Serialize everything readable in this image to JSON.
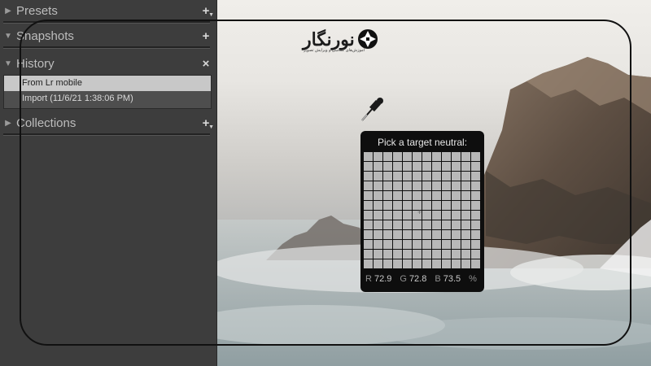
{
  "left_panel": {
    "sections": {
      "presets": {
        "title": "Presets",
        "action": "+"
      },
      "snapshots": {
        "title": "Snapshots",
        "action": "+"
      },
      "history": {
        "title": "History",
        "action": "×"
      },
      "collections": {
        "title": "Collections",
        "action": "+"
      }
    },
    "history_items": [
      "From Lr mobile",
      "Import (11/6/21 1:38:06 PM)"
    ]
  },
  "logo": {
    "text": "نورنگار",
    "subtitle": "آموزش‌های عکاسی و ویرایش تصویر"
  },
  "picker": {
    "title": "Pick a target neutral:",
    "r_label": "R",
    "r_value": "72.9",
    "g_label": "G",
    "g_value": "72.8",
    "b_label": "B",
    "b_value": "73.5",
    "unit": "%"
  },
  "colors": {
    "panel_bg": "#3d3d3d",
    "selected_row": "#c8c8c8",
    "picker_bg": "#0e0e0e",
    "outline": "#111111"
  }
}
